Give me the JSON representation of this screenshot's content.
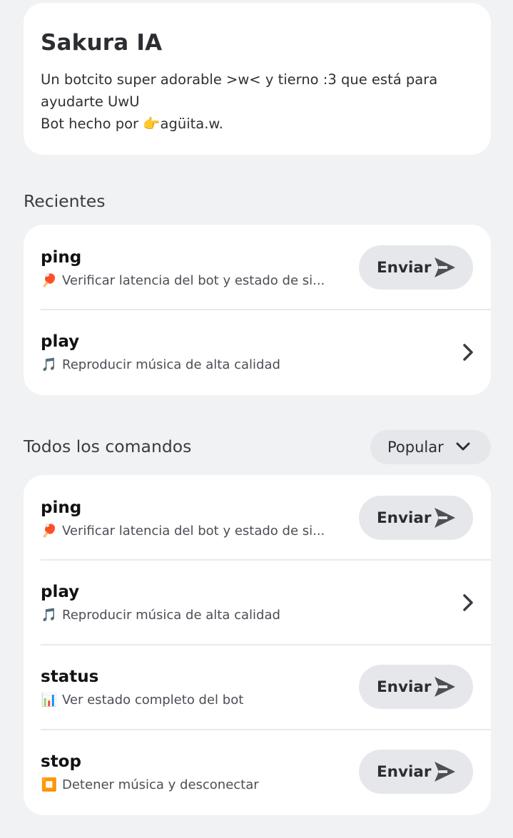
{
  "bot": {
    "name": "Sakura IA",
    "description_line1": "Un botcito super adorable >w< y tierno :3 que está para",
    "description_line2": "ayudarte UwU",
    "description_line3_prefix": "Bot hecho por ",
    "description_line3_emoji": "👉",
    "description_line3_author": "agüita.w."
  },
  "recientes": {
    "title": "Recientes",
    "items": [
      {
        "name": "ping",
        "emoji": "🏓",
        "desc": "Verificar latencia del bot y estado de si...",
        "action": "Enviar"
      },
      {
        "name": "play",
        "emoji": "🎵",
        "desc": "Reproducir música de alta calidad"
      }
    ]
  },
  "todos": {
    "title": "Todos los comandos",
    "sort_label": "Popular",
    "items": [
      {
        "name": "ping",
        "emoji": "🏓",
        "desc": "Verificar latencia del bot y estado de si...",
        "action": "Enviar"
      },
      {
        "name": "play",
        "emoji": "🎵",
        "desc": "Reproducir música de alta calidad"
      },
      {
        "name": "status",
        "emoji": "📊",
        "desc": "Ver estado completo del bot",
        "action": "Enviar"
      },
      {
        "name": "stop",
        "emoji": "⏹️",
        "desc": "Detener música y desconectar",
        "action": "Enviar"
      }
    ]
  },
  "icons": {
    "send": "send-icon",
    "chevron_right": "chevron-right-icon",
    "chevron_down": "chevron-down-icon"
  },
  "colors": {
    "background": "#f1f2f4",
    "card": "#ffffff",
    "button": "#e6e7ea",
    "text_primary": "#111214",
    "text_secondary": "#4c4e55"
  }
}
